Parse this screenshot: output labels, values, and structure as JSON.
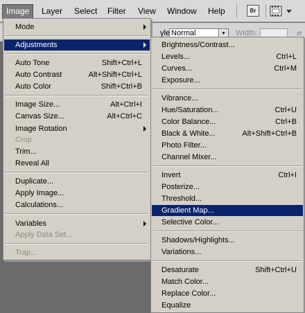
{
  "menubar": {
    "items": [
      "Image",
      "Layer",
      "Select",
      "Filter",
      "View",
      "Window",
      "Help"
    ],
    "bridge_label": "Br"
  },
  "options": {
    "style_label": "yle:",
    "style_value": "Normal",
    "width_label": "Width:"
  },
  "image_menu": {
    "mode": "Mode",
    "adjustments": "Adjustments",
    "auto_tone": {
      "label": "Auto Tone",
      "shortcut": "Shift+Ctrl+L"
    },
    "auto_contrast": {
      "label": "Auto Contrast",
      "shortcut": "Alt+Shift+Ctrl+L"
    },
    "auto_color": {
      "label": "Auto Color",
      "shortcut": "Shift+Ctrl+B"
    },
    "image_size": {
      "label": "Image Size...",
      "shortcut": "Alt+Ctrl+I"
    },
    "canvas_size": {
      "label": "Canvas Size...",
      "shortcut": "Alt+Ctrl+C"
    },
    "image_rotation": "Image Rotation",
    "crop": "Crop",
    "trim": "Trim...",
    "reveal_all": "Reveal All",
    "duplicate": "Duplicate...",
    "apply_image": "Apply Image...",
    "calculations": "Calculations...",
    "variables": "Variables",
    "apply_data_set": "Apply Data Set...",
    "trap": "Trap..."
  },
  "adjustments_menu": {
    "brightness_contrast": {
      "label": "Brightness/Contrast...",
      "shortcut": ""
    },
    "levels": {
      "label": "Levels...",
      "shortcut": "Ctrl+L"
    },
    "curves": {
      "label": "Curves...",
      "shortcut": "Ctrl+M"
    },
    "exposure": {
      "label": "Exposure...",
      "shortcut": ""
    },
    "vibrance": {
      "label": "Vibrance...",
      "shortcut": ""
    },
    "hue_saturation": {
      "label": "Hue/Saturation...",
      "shortcut": "Ctrl+U"
    },
    "color_balance": {
      "label": "Color Balance...",
      "shortcut": "Ctrl+B"
    },
    "black_white": {
      "label": "Black & White...",
      "shortcut": "Alt+Shift+Ctrl+B"
    },
    "photo_filter": {
      "label": "Photo Filter...",
      "shortcut": ""
    },
    "channel_mixer": {
      "label": "Channel Mixer...",
      "shortcut": ""
    },
    "invert": {
      "label": "Invert",
      "shortcut": "Ctrl+I"
    },
    "posterize": {
      "label": "Posterize...",
      "shortcut": ""
    },
    "threshold": {
      "label": "Threshold...",
      "shortcut": ""
    },
    "gradient_map": {
      "label": "Gradient Map...",
      "shortcut": ""
    },
    "selective_color": {
      "label": "Selective Color...",
      "shortcut": ""
    },
    "shadows_highlights": {
      "label": "Shadows/Highlights...",
      "shortcut": ""
    },
    "variations": {
      "label": "Variations...",
      "shortcut": ""
    },
    "desaturate": {
      "label": "Desaturate",
      "shortcut": "Shift+Ctrl+U"
    },
    "match_color": {
      "label": "Match Color...",
      "shortcut": ""
    },
    "replace_color": {
      "label": "Replace Color...",
      "shortcut": ""
    },
    "equalize": {
      "label": "Equalize",
      "shortcut": ""
    }
  },
  "colors": {
    "highlight": "#0a246a",
    "menu_bg": "#d4d0c8",
    "disabled_text": "#8c8c8c"
  }
}
